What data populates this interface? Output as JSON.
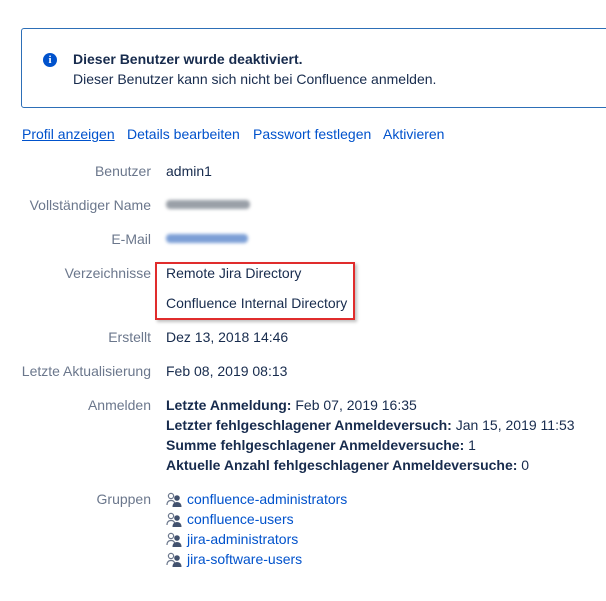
{
  "notice": {
    "icon": "info-icon",
    "title": "Dieser Benutzer wurde deaktiviert.",
    "text": "Dieser Benutzer kann sich nicht bei Confluence anmelden."
  },
  "actions": [
    "Profil anzeigen",
    "Details bearbeiten",
    "Passwort festlegen",
    "Aktivieren"
  ],
  "fields": {
    "user_label": "Benutzer",
    "user_value": "admin1",
    "fullname_label": "Vollständiger Name",
    "email_label": "E-Mail",
    "directories_label": "Verzeichnisse",
    "directories": [
      "Remote Jira Directory",
      "Confluence Internal Directory"
    ],
    "created_label": "Erstellt",
    "created_value": "Dez 13, 2018 14:46",
    "updated_label": "Letzte Aktualisierung",
    "updated_value": "Feb 08, 2019 08:13",
    "login_label": "Anmelden",
    "login": [
      {
        "label": "Letzte Anmeldung:",
        "value": "Feb 07, 2019 16:35"
      },
      {
        "label": "Letzter fehlgeschlagener Anmeldeversuch:",
        "value": "Jan 15, 2019 11:53"
      },
      {
        "label": "Summe fehlgeschlagener Anmeldeversuche:",
        "value": "1"
      },
      {
        "label": "Aktuelle Anzahl fehlgeschlagener Anmeldeversuche:",
        "value": "0"
      }
    ],
    "groups_label": "Gruppen",
    "groups": [
      "confluence-administrators",
      "confluence-users",
      "jira-administrators",
      "jira-software-users"
    ]
  },
  "colors": {
    "link": "#0052cc",
    "label": "#6b778c",
    "notice_border": "#2d6fb7",
    "highlight": "#e02c2c"
  }
}
